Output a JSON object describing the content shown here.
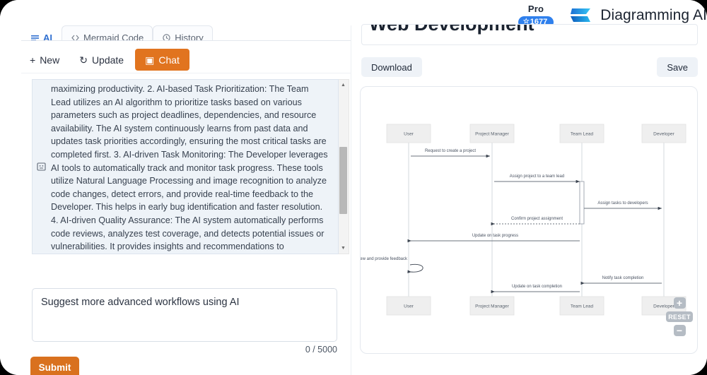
{
  "brand": {
    "plan_label": "Pro",
    "credits": "1677",
    "star_icon": "star-icon",
    "name": "Diagramming AI"
  },
  "left_panel": {
    "tabs": [
      {
        "label": "AI",
        "icon": "ai-lines-icon",
        "active": true
      },
      {
        "label": "Mermaid Code",
        "icon": "code-icon",
        "active": false
      },
      {
        "label": "History",
        "icon": "history-icon",
        "active": false
      }
    ],
    "toolbar": [
      {
        "label": "New",
        "glyph": "+",
        "active": false
      },
      {
        "label": "Update",
        "glyph": "↻",
        "active": false
      },
      {
        "label": "Chat",
        "glyph": "▣",
        "active": true
      }
    ],
    "message": {
      "avatar_icon": "bot-message-icon",
      "text": "maximizing productivity. 2. AI-based Task Prioritization: The Team Lead utilizes an AI algorithm to prioritize tasks based on various parameters such as project deadlines, dependencies, and resource availability. The AI system continuously learns from past data and updates task priorities accordingly, ensuring the most critical tasks are completed first. 3. AI-driven Task Monitoring: The Developer leverages AI tools to automatically track and monitor task progress. These tools utilize Natural Language Processing and image recognition to analyze code changes, detect errors, and provide real-time feedback to the Developer. This helps in early bug identification and faster resolution. 4. AI-driven Quality Assurance: The AI system automatically performs code reviews, analyzes test coverage, and detects potential issues or vulnerabilities. It provides insights and recommendations to Developers and Team Leads, ensuring high-quality deliverables and reducing the likelihood of bugs or security"
    },
    "composer": {
      "value": "Suggest more advanced workflows using AI",
      "placeholder": "",
      "counter": "0 / 5000",
      "submit_label": "Submit"
    }
  },
  "right_panel": {
    "title": "Web Development",
    "download_label": "Download",
    "save_label": "Save",
    "zoom_controls": {
      "zoom_in": "+",
      "reset": "RESET",
      "zoom_out": "−"
    }
  },
  "chart_data": {
    "type": "diagram",
    "diagram_type": "sequence",
    "title": "Web Development",
    "participants": [
      "User",
      "Project Manager",
      "Team Lead",
      "Developer"
    ],
    "messages": [
      {
        "from": "User",
        "to": "Project Manager",
        "label": "Request to create a project",
        "style": "solid"
      },
      {
        "from": "Project Manager",
        "to": "Team Lead",
        "label": "Assign project to a team lead",
        "style": "solid"
      },
      {
        "from": "Team Lead",
        "to": "Developer",
        "label": "Assign tasks to developers",
        "style": "solid"
      },
      {
        "from": "Team Lead",
        "to": "Project Manager",
        "label": "Confirm project assignment",
        "style": "dashed"
      },
      {
        "from": "Team Lead",
        "to": "User",
        "label": "Update on task progress",
        "style": "solid"
      },
      {
        "from": "User",
        "to": "User",
        "label": "Review and provide feedback",
        "style": "self-loop"
      },
      {
        "from": "Developer",
        "to": "Team Lead",
        "label": "Notify task completion",
        "style": "solid"
      },
      {
        "from": "Team Lead",
        "to": "Project Manager",
        "label": "Update on task completion",
        "style": "solid"
      }
    ]
  }
}
